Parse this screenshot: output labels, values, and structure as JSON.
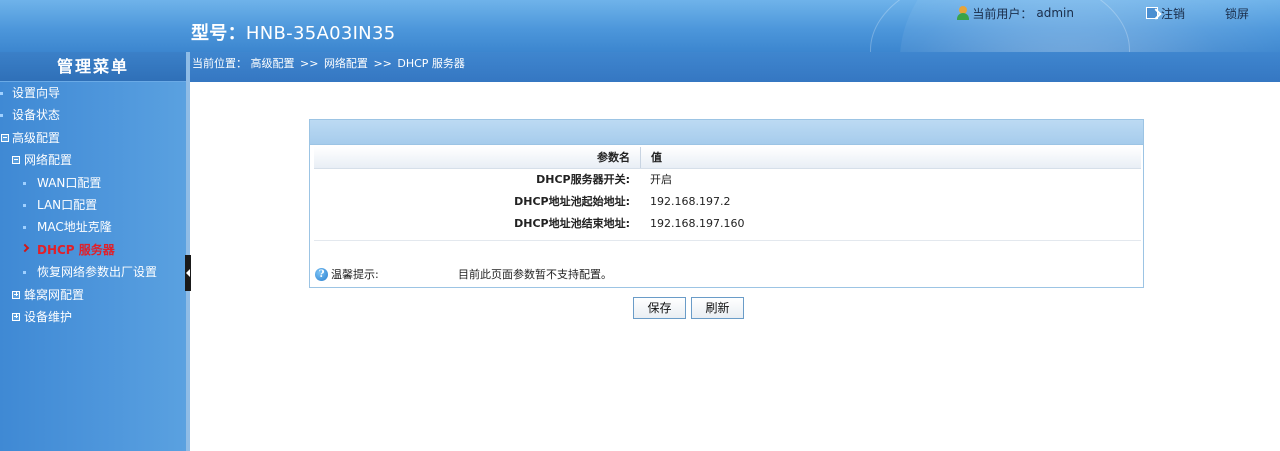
{
  "header": {
    "model_label": "型号：",
    "model_value": "HNB-35A03IN35",
    "current_user_label": "当前用户：",
    "current_user": "admin",
    "logout": "注销",
    "lock_screen": "锁屏"
  },
  "sidebar": {
    "title": "管理菜单",
    "items": [
      {
        "label": "设置向导"
      },
      {
        "label": "设备状态"
      },
      {
        "label": "高级配置"
      },
      {
        "label": "网络配置"
      },
      {
        "label": "WAN口配置"
      },
      {
        "label": "LAN口配置"
      },
      {
        "label": "MAC地址克隆"
      },
      {
        "label": "DHCP 服务器"
      },
      {
        "label": "恢复网络参数出厂设置"
      },
      {
        "label": "蜂窝网配置"
      },
      {
        "label": "设备维护"
      }
    ]
  },
  "breadcrumb": {
    "label": "当前位置：",
    "path": [
      "高级配置",
      "网络配置",
      "DHCP 服务器"
    ],
    "separator": ">>"
  },
  "table": {
    "header_name": "参数名",
    "header_value": "值",
    "rows": [
      {
        "name": "DHCP服务器开关:",
        "value": "开启"
      },
      {
        "name": "DHCP地址池起始地址:",
        "value": "192.168.197.2"
      },
      {
        "name": "DHCP地址池结束地址:",
        "value": "192.168.197.160"
      }
    ]
  },
  "tip": {
    "label": "温馨提示:",
    "text": "目前此页面参数暂不支持配置。"
  },
  "buttons": {
    "save": "保存",
    "refresh": "刷新"
  },
  "colors": {
    "header_blue": "#4d97db",
    "sidebar_blue": "#4f97dc",
    "active_item": "#e0202a",
    "panel_border": "#9cc4e4"
  }
}
